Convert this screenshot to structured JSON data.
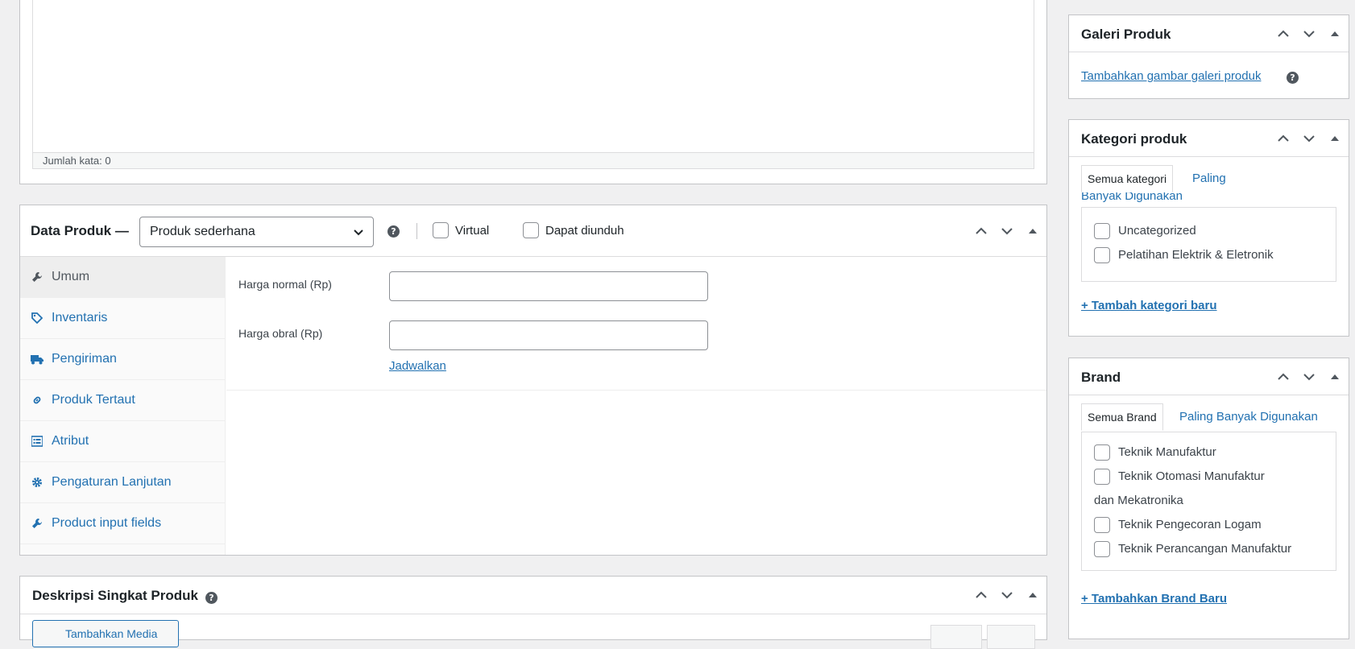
{
  "editor": {
    "word_count": "Jumlah kata: 0"
  },
  "data_produk": {
    "title": "Data Produk —",
    "product_type": "Produk sederhana",
    "virtual_label": "Virtual",
    "downloadable_label": "Dapat diunduh",
    "tabs": [
      {
        "label": "Umum",
        "icon": "wrench-icon",
        "active": true
      },
      {
        "label": "Inventaris",
        "icon": "tag-icon"
      },
      {
        "label": "Pengiriman",
        "icon": "truck-icon"
      },
      {
        "label": "Produk Tertaut",
        "icon": "link-icon"
      },
      {
        "label": "Atribut",
        "icon": "list-icon"
      },
      {
        "label": "Pengaturan Lanjutan",
        "icon": "gear-icon"
      },
      {
        "label": "Product input fields",
        "icon": "wrench-icon"
      }
    ],
    "regular_price_label": "Harga normal (Rp)",
    "regular_price_value": "",
    "sale_price_label": "Harga obral (Rp)",
    "sale_price_value": "",
    "schedule_link": "Jadwalkan"
  },
  "deskripsi": {
    "title": "Deskripsi Singkat Produk",
    "media_button": "Tambahkan Media"
  },
  "galeri": {
    "title": "Galeri Produk",
    "add_link": "Tambahkan gambar galeri produk"
  },
  "kategori": {
    "title": "Kategori produk",
    "tab_all": "Semua kategori",
    "tab_popular_1": "Paling",
    "tab_popular_2": "Banyak Digunakan",
    "items": [
      "Uncategorized",
      "Pelatihan Elektrik & Eletronik"
    ],
    "add_link": "+ Tambah kategori baru"
  },
  "brand": {
    "title": "Brand",
    "tab_all": "Semua Brand",
    "tab_popular": "Paling Banyak Digunakan",
    "items": [
      "Teknik Manufaktur",
      "Teknik Otomasi Manufaktur",
      "dan Mekatronika",
      "Teknik Pengecoran Logam",
      "Teknik Perancangan Manufaktur"
    ],
    "add_link": "+ Tambahkan Brand Baru"
  },
  "colors": {
    "link": "#2271b1",
    "border": "#c3c4c7",
    "background": "#f0f0f1"
  }
}
